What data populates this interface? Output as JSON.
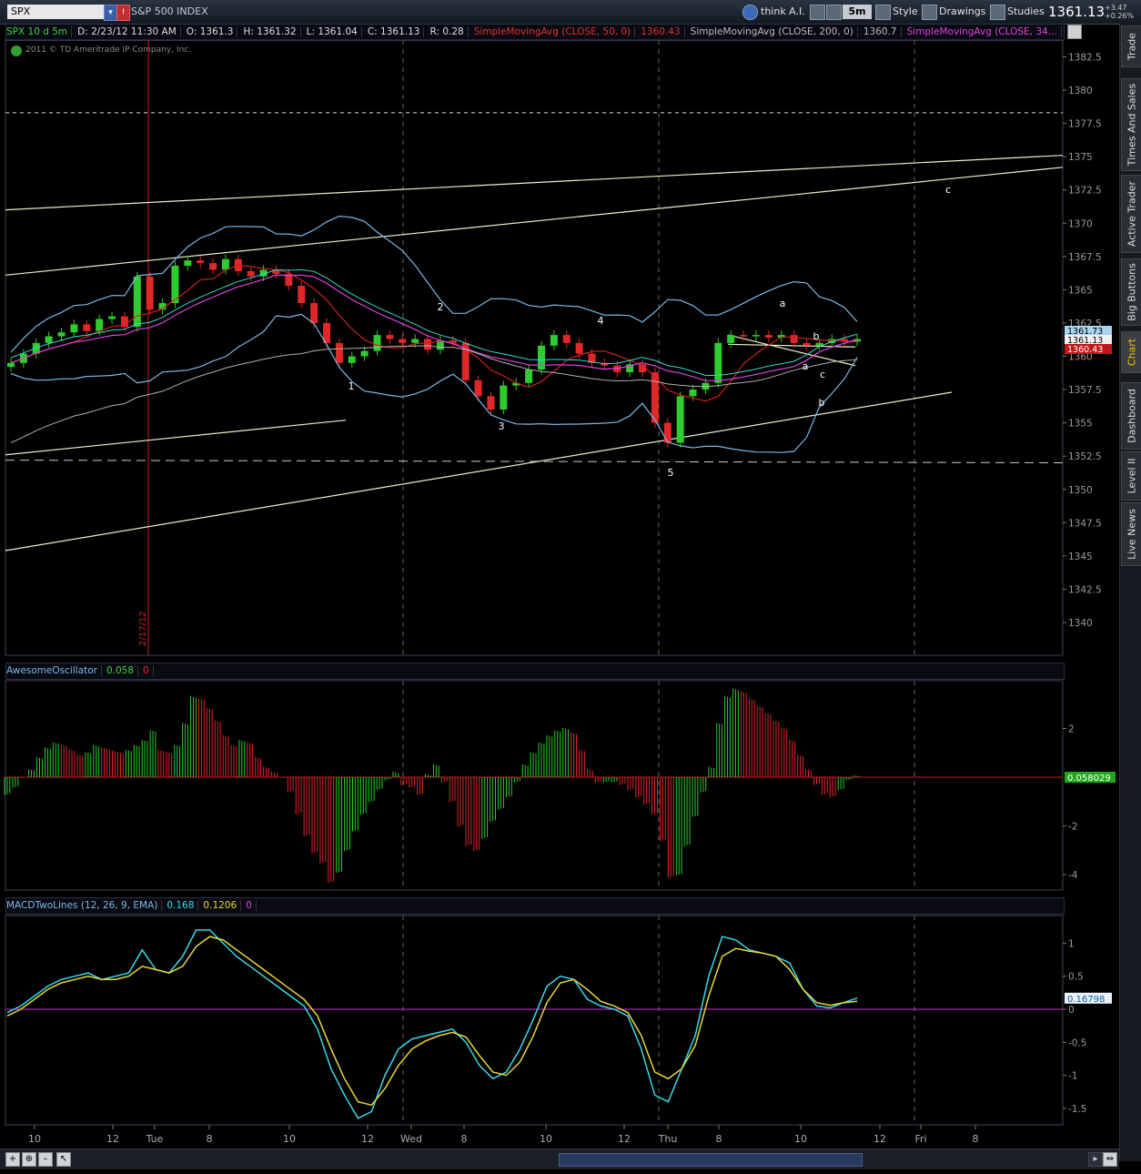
{
  "toolbar": {
    "symbol": "SPX",
    "index_name": "S&P 500 INDEX",
    "think_label": "think A.I.",
    "timeframe": "5m",
    "style_label": "Style",
    "drawings_label": "Drawings",
    "studies_label": "Studies",
    "last_price": "1361.13",
    "change": "+3.47",
    "change_pct": "+0.26%"
  },
  "infobar": {
    "period": "SPX 10 d 5m",
    "date": "D: 2/23/12 11:30 AM",
    "open": "O: 1361.3",
    "high": "H: 1361.32",
    "low": "L: 1361.04",
    "close": "C: 1361.13",
    "range": "R: 0.28",
    "sma50_label": "SimpleMovingAvg (CLOSE, 50, 0)",
    "sma50_value": "1360.43",
    "sma200_label": "SimpleMovingAvg (CLOSE, 200, 0)",
    "sma200_value": "1360.7",
    "sma34_label": "SimpleMovingAvg (CLOSE, 34..."
  },
  "copyright": "2011 © TD Ameritrade IP Company, Inc.",
  "sidebar": {
    "tabs": [
      "Trade",
      "Times And Sales",
      "Active Trader",
      "Big Buttons",
      "Chart",
      "Dashboard",
      "Level II",
      "Live News"
    ]
  },
  "ao_bar": {
    "label": "AwesomeOscillator",
    "value": "0.058",
    "zero": "0",
    "readout": "0.058029"
  },
  "macd_bar": {
    "label": "MACDTwoLines (12, 26, 9, EMA)",
    "value": "0.168",
    "avg": "0.1206",
    "zero": "0",
    "readout": "0.16798"
  },
  "colors": {
    "up": "#2ecc2e",
    "down": "#e02828",
    "bollinger": "#7ab8e8",
    "sma50": "#d02020",
    "sma200": "#b0b0b0",
    "sma34": "#e040e0",
    "macd_value": "#38d8e8",
    "macd_avg": "#e8d838",
    "trend": "#e8f0c8"
  },
  "chart_data": [
    {
      "type": "candlestick",
      "title": "SPX 10 d 5m",
      "ylim": [
        1337.5,
        1383.75
      ],
      "yticks": [
        "1382.5",
        "1380",
        "1377.5",
        "1375",
        "1372.5",
        "1370",
        "1367.5",
        "1365",
        "1362.5",
        "1360",
        "1357.5",
        "1355",
        "1352.5",
        "1350",
        "1347.5",
        "1345",
        "1342.5",
        "1340"
      ],
      "x_labels": [
        "10",
        "12",
        "Tue",
        "8",
        "10",
        "12",
        "Wed",
        "8",
        "10",
        "12",
        "Thu",
        "8",
        "10",
        "12",
        "Fri",
        "8"
      ],
      "date_marker": "2/17/12",
      "price_tags": [
        "1361.73",
        "1361.13",
        "1360.43"
      ],
      "wave_labels": [
        "1",
        "2",
        "3",
        "4",
        "5",
        "a",
        "b",
        "c",
        "a",
        "b",
        "c"
      ],
      "series": [
        {
          "name": "close",
          "values": [
            1359.5,
            1360.2,
            1361.0,
            1361.5,
            1361.8,
            1362.4,
            1361.9,
            1362.8,
            1363.0,
            1362.2,
            1366.0,
            1363.5,
            1364.0,
            1366.8,
            1367.2,
            1367.0,
            1366.5,
            1367.3,
            1366.4,
            1366.0,
            1366.5,
            1366.2,
            1365.3,
            1364.0,
            1362.5,
            1361.0,
            1359.5,
            1360.0,
            1360.4,
            1361.6,
            1361.3,
            1361.0,
            1361.3,
            1360.5,
            1361.2,
            1361.0,
            1358.2,
            1357.0,
            1356.0,
            1357.8,
            1358.0,
            1359.0,
            1360.8,
            1361.6,
            1361.0,
            1360.2,
            1359.5,
            1359.3,
            1358.8,
            1359.4,
            1358.8,
            1355.0,
            1353.5,
            1357.0,
            1357.5,
            1358.0,
            1361.0,
            1361.6,
            1361.5,
            1361.6,
            1361.4,
            1361.6,
            1361.0,
            1360.8,
            1361.0,
            1361.3,
            1361.1,
            1361.3
          ]
        }
      ]
    },
    {
      "type": "bar",
      "title": "AwesomeOscillator",
      "ylim": [
        -4.5,
        3.7
      ],
      "yticks": [
        "2",
        "-2",
        "-4"
      ],
      "values": [
        -0.7,
        -0.4,
        0.0,
        0.3,
        0.8,
        1.2,
        1.4,
        1.3,
        1.1,
        0.9,
        1.0,
        1.3,
        1.2,
        1.1,
        1.0,
        1.1,
        1.3,
        1.5,
        1.9,
        1.1,
        1.0,
        1.3,
        2.2,
        3.3,
        3.2,
        2.8,
        2.3,
        1.7,
        1.3,
        1.5,
        1.4,
        0.8,
        0.4,
        0.2,
        0.0,
        -0.6,
        -1.5,
        -2.4,
        -3.1,
        -3.5,
        -4.3,
        -3.9,
        -3.0,
        -2.2,
        -1.5,
        -1.0,
        -0.5,
        -0.1,
        0.2,
        -0.3,
        -0.4,
        -0.7,
        0.1,
        0.5,
        -0.2,
        -1.0,
        -2.0,
        -2.8,
        -3.0,
        -2.5,
        -1.8,
        -1.3,
        -0.8,
        -0.2,
        0.5,
        1.0,
        1.4,
        1.7,
        1.9,
        2.0,
        1.8,
        1.1,
        0.3,
        -0.2,
        -0.2,
        -0.2,
        -0.3,
        -0.5,
        -0.8,
        -1.1,
        -1.5,
        -2.6,
        -4.1,
        -4.0,
        -2.8,
        -1.6,
        -0.6,
        0.4,
        2.2,
        3.3,
        3.6,
        3.5,
        3.2,
        2.9,
        2.6,
        2.3,
        2.0,
        1.5,
        0.9,
        0.3,
        -0.3,
        -0.7,
        -0.8,
        -0.5,
        -0.1,
        0.06
      ]
    },
    {
      "type": "line",
      "title": "MACDTwoLines (12, 26, 9, EMA)",
      "ylim": [
        -1.75,
        1.3
      ],
      "yticks": [
        "1",
        "0.5",
        "0",
        "-0.5",
        "-1",
        "-1.5"
      ],
      "series": [
        {
          "name": "Value",
          "values": [
            -0.05,
            0.05,
            0.2,
            0.35,
            0.45,
            0.5,
            0.55,
            0.45,
            0.5,
            0.55,
            0.9,
            0.6,
            0.55,
            0.8,
            1.2,
            1.2,
            1.0,
            0.8,
            0.65,
            0.5,
            0.35,
            0.2,
            0.05,
            -0.3,
            -0.9,
            -1.3,
            -1.65,
            -1.55,
            -1.0,
            -0.6,
            -0.45,
            -0.4,
            -0.35,
            -0.3,
            -0.5,
            -0.85,
            -1.05,
            -0.95,
            -0.6,
            -0.15,
            0.35,
            0.5,
            0.45,
            0.15,
            0.05,
            0.0,
            -0.1,
            -0.6,
            -1.3,
            -1.4,
            -0.9,
            -0.4,
            0.5,
            1.1,
            1.05,
            0.9,
            0.85,
            0.8,
            0.7,
            0.3,
            0.05,
            0.02,
            0.1,
            0.17
          ]
        },
        {
          "name": "Avg",
          "values": [
            -0.1,
            0.0,
            0.15,
            0.3,
            0.4,
            0.45,
            0.5,
            0.45,
            0.45,
            0.5,
            0.65,
            0.6,
            0.55,
            0.65,
            0.95,
            1.1,
            1.05,
            0.9,
            0.75,
            0.6,
            0.45,
            0.3,
            0.15,
            -0.1,
            -0.6,
            -1.05,
            -1.4,
            -1.45,
            -1.2,
            -0.85,
            -0.6,
            -0.48,
            -0.4,
            -0.35,
            -0.42,
            -0.7,
            -0.95,
            -1.0,
            -0.8,
            -0.4,
            0.1,
            0.4,
            0.45,
            0.3,
            0.12,
            0.05,
            -0.05,
            -0.4,
            -0.95,
            -1.05,
            -0.9,
            -0.55,
            0.2,
            0.8,
            0.92,
            0.88,
            0.85,
            0.8,
            0.6,
            0.3,
            0.1,
            0.06,
            0.1,
            0.12
          ]
        }
      ]
    }
  ]
}
